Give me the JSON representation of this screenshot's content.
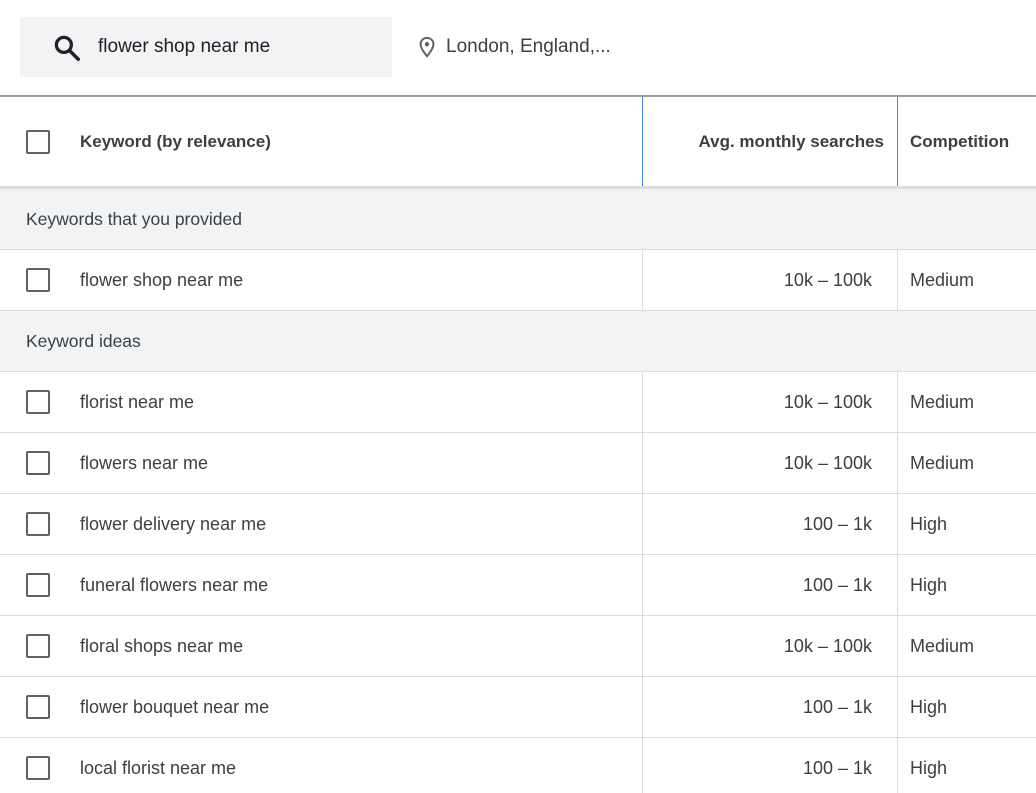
{
  "search": {
    "query": "flower shop near me",
    "location": "London, England,..."
  },
  "table": {
    "columns": {
      "keyword": "Keyword (by relevance)",
      "avg_monthly_searches": "Avg. monthly searches",
      "competition": "Competition"
    },
    "provided_group_label": "Keywords that you provided",
    "provided": [
      {
        "keyword": "flower shop near me",
        "avg": "10k – 100k",
        "competition": "Medium",
        "checked": false
      }
    ],
    "ideas_group_label": "Keyword ideas",
    "ideas": [
      {
        "keyword": "florist near me",
        "avg": "10k – 100k",
        "competition": "Medium",
        "checked": false
      },
      {
        "keyword": "flowers near me",
        "avg": "10k – 100k",
        "competition": "Medium",
        "checked": false
      },
      {
        "keyword": "flower delivery near me",
        "avg": "100 – 1k",
        "competition": "High",
        "checked": false
      },
      {
        "keyword": "funeral flowers near me",
        "avg": "100 – 1k",
        "competition": "High",
        "checked": false
      },
      {
        "keyword": "floral shops near me",
        "avg": "10k – 100k",
        "competition": "Medium",
        "checked": false
      },
      {
        "keyword": "flower bouquet near me",
        "avg": "100 – 1k",
        "competition": "High",
        "checked": false
      },
      {
        "keyword": "local florist near me",
        "avg": "100 – 1k",
        "competition": "High",
        "checked": false
      }
    ]
  },
  "icons": {
    "search": "search-icon",
    "location": "location-pin-icon",
    "checkbox": "checkbox-icon"
  },
  "colors": {
    "column_divider_accent": "#4285f4",
    "group_background": "#f1f3f4",
    "text": "#3c4043"
  }
}
